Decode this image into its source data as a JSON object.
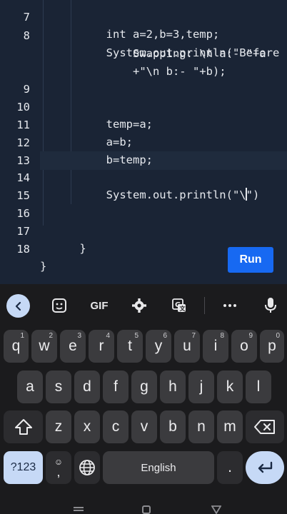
{
  "editor": {
    "lines": [
      {
        "num": "7",
        "code": "        int a=2,b=3,temp;"
      },
      {
        "num": "8",
        "code": "        System.out.println(\"Before"
      },
      {
        "num": "",
        "code": "            Swapping: \\n a:- \"+a"
      },
      {
        "num": "",
        "code": "            +\"\\n b:- \"+b);"
      },
      {
        "num": "9",
        "code": ""
      },
      {
        "num": "10",
        "code": "        temp=a;"
      },
      {
        "num": "11",
        "code": "        a=b;"
      },
      {
        "num": "12",
        "code": "        b=temp;"
      },
      {
        "num": "13",
        "code": ""
      },
      {
        "num": "14",
        "code_before_cursor": "        System.out.println(\"\\",
        "code_after_cursor": "\")"
      },
      {
        "num": "15",
        "code": ""
      },
      {
        "num": "16",
        "code": ""
      },
      {
        "num": "17",
        "code": "    }"
      },
      {
        "num": "18",
        "code": "}"
      }
    ],
    "run_label": "Run"
  },
  "keyboard": {
    "toolbar": {
      "back_icon": "chevron-left-icon",
      "sticker_icon": "sticker-icon",
      "gif_label": "GIF",
      "settings_icon": "gear-icon",
      "translate_icon": "translate-icon",
      "more_icon": "more-horizontal-icon",
      "mic_icon": "microphone-icon"
    },
    "row1": [
      {
        "label": "q",
        "hint": "1"
      },
      {
        "label": "w",
        "hint": "2"
      },
      {
        "label": "e",
        "hint": "3"
      },
      {
        "label": "r",
        "hint": "4"
      },
      {
        "label": "t",
        "hint": "5"
      },
      {
        "label": "y",
        "hint": "6"
      },
      {
        "label": "u",
        "hint": "7"
      },
      {
        "label": "i",
        "hint": "8"
      },
      {
        "label": "o",
        "hint": "9"
      },
      {
        "label": "p",
        "hint": "0"
      }
    ],
    "row2": [
      "a",
      "s",
      "d",
      "f",
      "g",
      "h",
      "j",
      "k",
      "l"
    ],
    "row3": [
      "z",
      "x",
      "c",
      "v",
      "b",
      "n",
      "m"
    ],
    "symbols_label": "?123",
    "emoji_comma_label": ",",
    "space_label": "English",
    "period_label": "."
  }
}
